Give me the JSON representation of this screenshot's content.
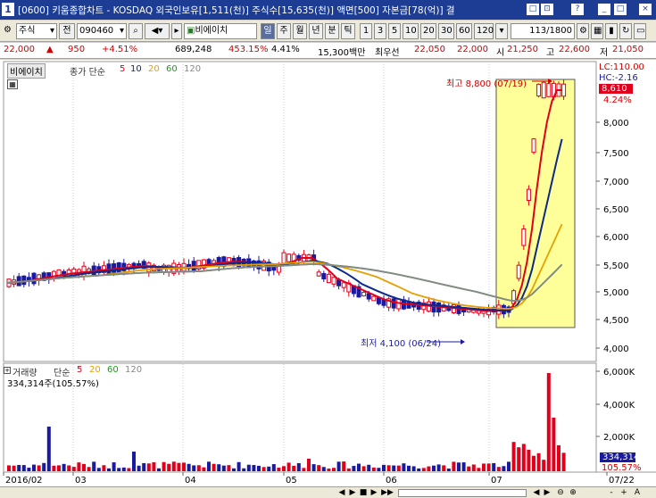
{
  "titlebar": {
    "num": "1",
    "text": "[0600] 키움종합차트 - KOSDAQ 외국인보유[1,511(천)] 주식수[15,635(천)] 액면[500] 자본금[78(억)] 결",
    "buttons": [
      "□",
      "⊡",
      "?",
      "_",
      "□",
      "×"
    ]
  },
  "toolbar": {
    "type_select": "주식",
    "prev_label": "전",
    "code_input": "090460",
    "stock_name": "비에이치",
    "mode_day": "일",
    "periods": [
      "주",
      "월",
      "년",
      "분",
      "틱"
    ],
    "intervals": [
      "1",
      "3",
      "5",
      "10",
      "20",
      "30",
      "60",
      "120"
    ],
    "page_counter": "113",
    "page_total": "/1800"
  },
  "pricebar": {
    "price": "22,000",
    "change_icon": "up-triangle",
    "change": "950",
    "change_pct": "+4.51%",
    "volume": "689,248",
    "vol_ratio": "453.15%",
    "turnover": "4.41%",
    "amount": "15,300백만",
    "pref_label": "최우선",
    "bid": "22,050",
    "ask": "22,000",
    "open_label": "시",
    "open": "21,250",
    "high_label": "고",
    "high": "22,600",
    "low_label": "저",
    "low": "21,050"
  },
  "price_pane": {
    "name_label": "비에이치",
    "ma_label": "종가 단순",
    "ma_periods": [
      "5",
      "10",
      "20",
      "60",
      "120"
    ],
    "ma_colors": [
      "#e0001b",
      "#0b2a8a",
      "#e8a000",
      "#18a018",
      "#888888"
    ],
    "lc_label": "LC:110.00",
    "hc_label": "HC:-2.16",
    "current_price": "8,610",
    "current_pct": "4.24%",
    "y_ticks": [
      "8,000",
      "7,500",
      "7,000",
      "6,500",
      "6,000",
      "5,500",
      "5,000",
      "4,500",
      "4,000"
    ],
    "high_annotation": "최고 8,800 (07/19)",
    "low_annotation": "최저 4,100 (06/24)"
  },
  "volume_pane": {
    "name_label": "거래량",
    "ma_label": "단순",
    "ma_periods": [
      "5",
      "20",
      "60",
      "120"
    ],
    "value_label": "334,314주(105.57%)",
    "y_ticks": [
      "6,000K",
      "4,000K",
      "2,000K"
    ],
    "current_value": "334,314",
    "current_pct": "105.57%"
  },
  "x_axis": {
    "labels": [
      "2016/02",
      "03",
      "04",
      "05",
      "06",
      "07",
      "07/22"
    ]
  },
  "bottomnav": {
    "buttons": [
      "◀",
      "▶",
      "■",
      "▶",
      "▶▶",
      "◀",
      "▶",
      "⊖",
      "⊕",
      "-",
      "+",
      "A"
    ]
  },
  "chart_data": {
    "type": "candlestick",
    "y_axis_range": [
      3900,
      8900
    ],
    "annotations": [
      {
        "label": "최고",
        "value": 8800,
        "date": "07/19"
      },
      {
        "label": "최저",
        "value": 4100,
        "date": "06/24"
      }
    ]
  }
}
